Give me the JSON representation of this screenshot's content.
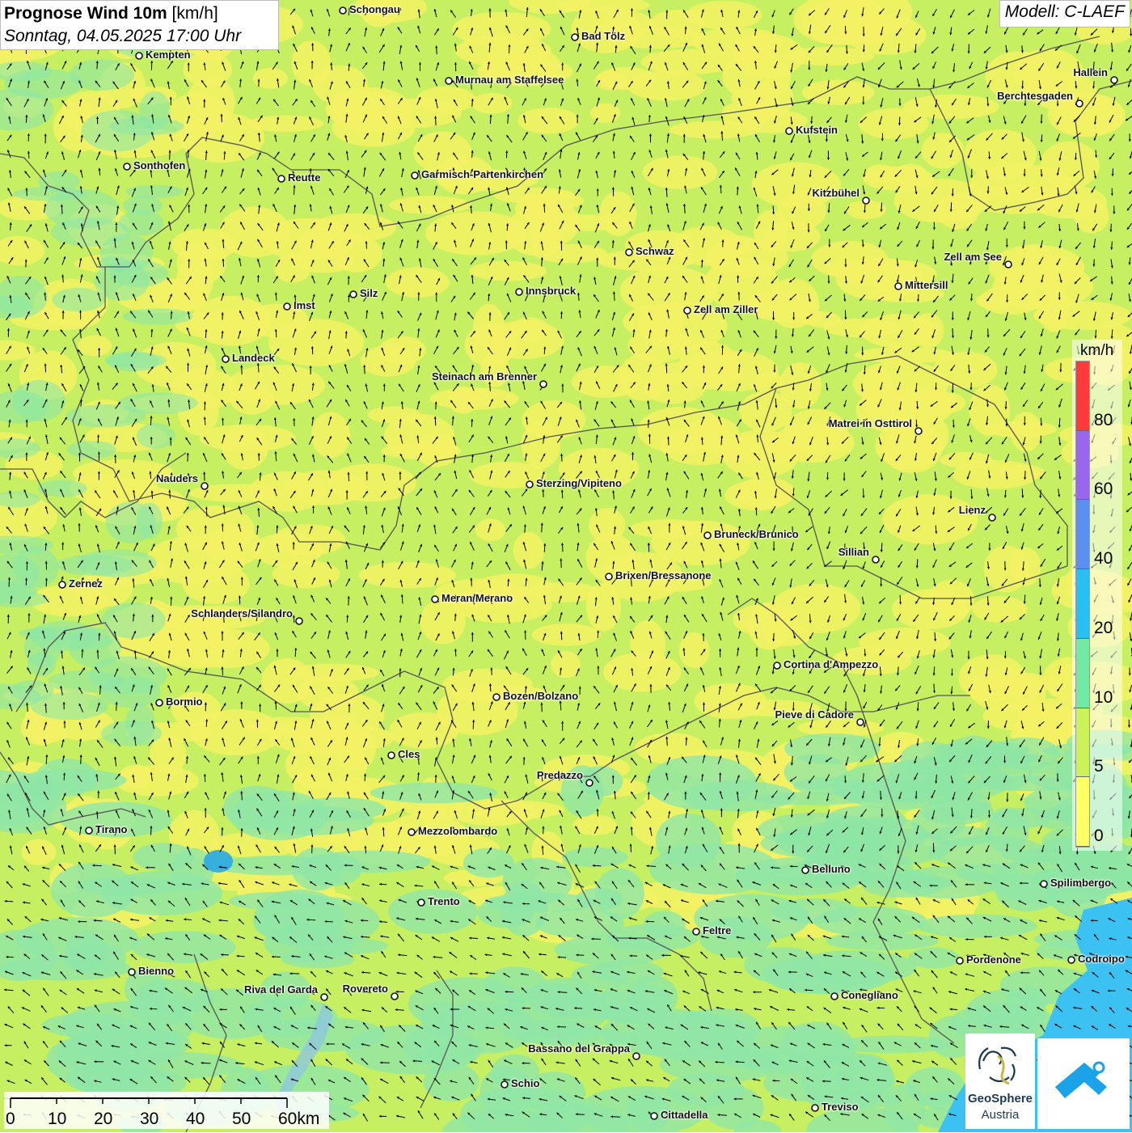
{
  "header": {
    "title_bold": "Prognose Wind 10m",
    "title_unit": "[km/h]",
    "datetime": "Sonntag, 04.05.2025 17:00 Uhr",
    "model": "Modell: C-LAEF"
  },
  "legend": {
    "unit": "km/h",
    "ticks": [
      "80",
      "60",
      "40",
      "20",
      "10",
      "5",
      "0"
    ],
    "colors": [
      "#ff3a3a",
      "#9966ee",
      "#5b8ff0",
      "#29bff2",
      "#72eaa3",
      "#ccf25a",
      "#ffff66"
    ]
  },
  "scale": {
    "labels": [
      "0",
      "10",
      "20",
      "30",
      "40",
      "50",
      "60km"
    ]
  },
  "logos": {
    "geosphere_line1": "GeoSphere",
    "geosphere_line2": "Austria",
    "app_icon": "wind-app-icon"
  },
  "map_colors": {
    "calm": "#f3f264",
    "light": "#c6ef62",
    "moderate": "#8ee6a6",
    "sea": "#3cc2f2",
    "border": "#555555"
  },
  "cities": [
    {
      "name": "Schongau"
    },
    {
      "name": "Bad Tölz"
    },
    {
      "name": "Kempten"
    },
    {
      "name": "Murnau am Staffelsee"
    },
    {
      "name": "Hallein"
    },
    {
      "name": "Berchtesgaden"
    },
    {
      "name": "Kufstein"
    },
    {
      "name": "Sonthofen"
    },
    {
      "name": "Reutte"
    },
    {
      "name": "Garmisch-Partenkirchen"
    },
    {
      "name": "Kitzbühel"
    },
    {
      "name": "Schwaz"
    },
    {
      "name": "Zell am See"
    },
    {
      "name": "Mittersill"
    },
    {
      "name": "Innsbruck"
    },
    {
      "name": "Silz"
    },
    {
      "name": "Imst"
    },
    {
      "name": "Zell am Ziller"
    },
    {
      "name": "Landeck"
    },
    {
      "name": "Steinach am Brenner"
    },
    {
      "name": "Matrei in Osttirol"
    },
    {
      "name": "Nauders"
    },
    {
      "name": "Sterzing/Vipiteno"
    },
    {
      "name": "Lienz"
    },
    {
      "name": "Bruneck/Brunico"
    },
    {
      "name": "Sillian"
    },
    {
      "name": "Brixen/Bressanone"
    },
    {
      "name": "Zernez"
    },
    {
      "name": "Meran/Merano"
    },
    {
      "name": "Schlanders/Silandro"
    },
    {
      "name": "Cortina d'Ampezzo"
    },
    {
      "name": "Bozen/Bolzano"
    },
    {
      "name": "Bormio"
    },
    {
      "name": "Pieve di Cadore"
    },
    {
      "name": "Cles"
    },
    {
      "name": "Predazzo"
    },
    {
      "name": "Tirano"
    },
    {
      "name": "Mezzolombardo"
    },
    {
      "name": "Belluno"
    },
    {
      "name": "Spilimbergo"
    },
    {
      "name": "Trento"
    },
    {
      "name": "Feltre"
    },
    {
      "name": "Pordenone"
    },
    {
      "name": "Codroipo"
    },
    {
      "name": "Bienno"
    },
    {
      "name": "Riva del Garda"
    },
    {
      "name": "Rovereto"
    },
    {
      "name": "Conegliano"
    },
    {
      "name": "Bassano del Grappa"
    },
    {
      "name": "Schio"
    },
    {
      "name": "Treviso"
    },
    {
      "name": "Cittadella"
    }
  ]
}
